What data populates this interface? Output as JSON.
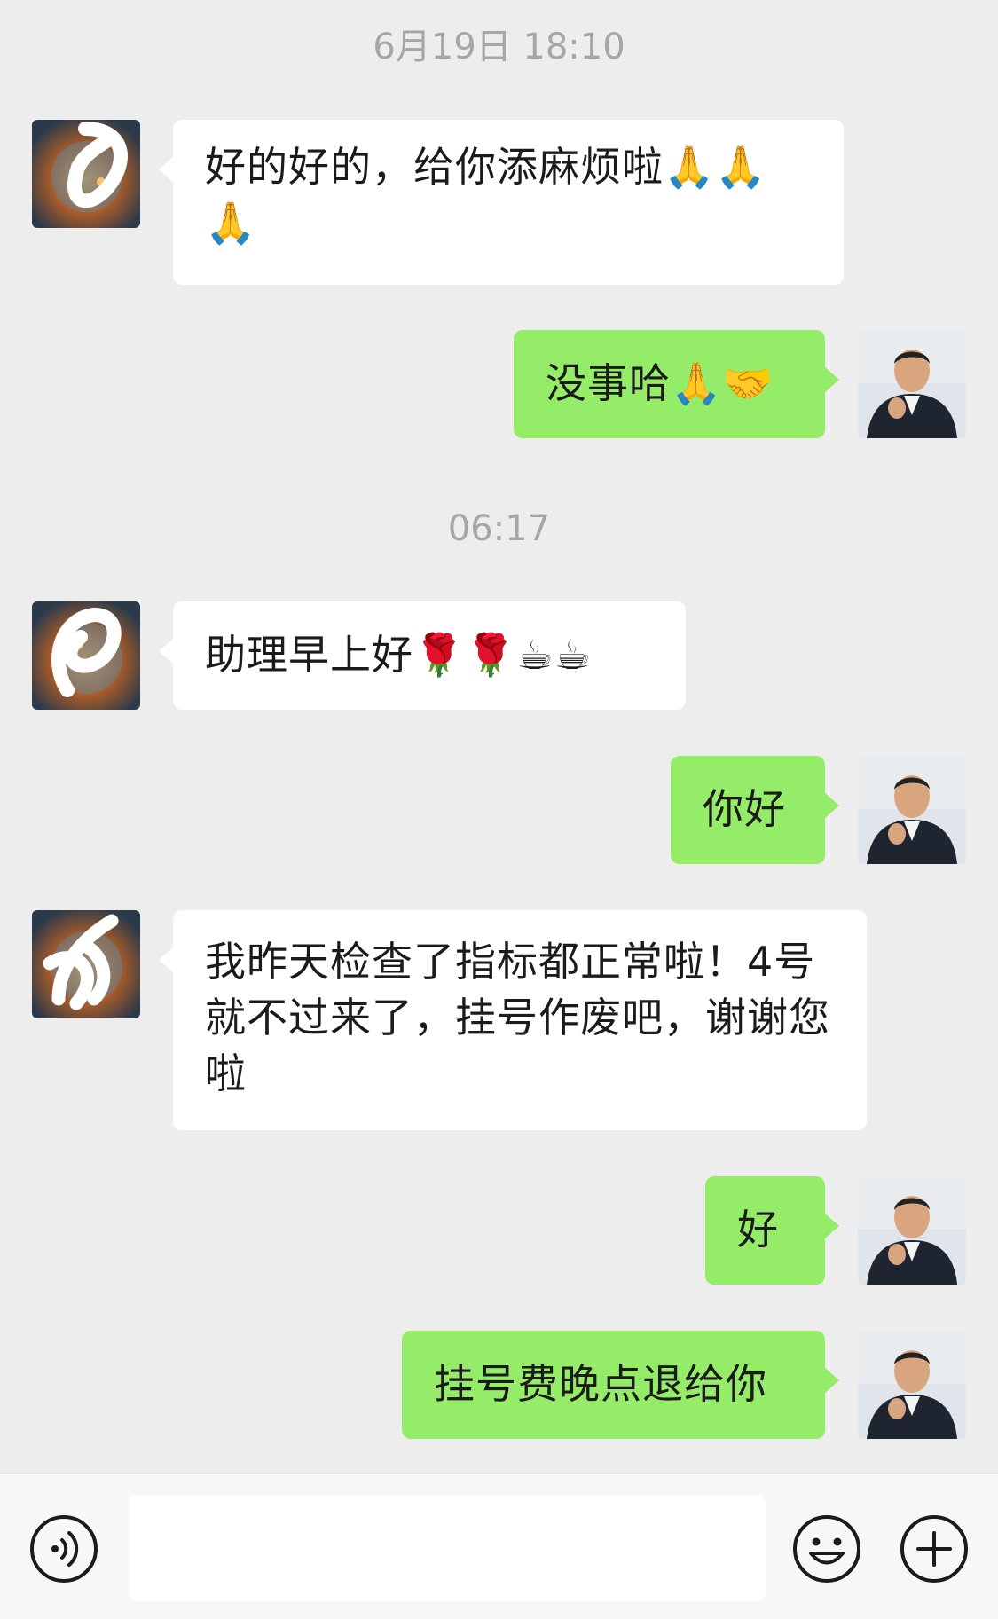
{
  "timestamps": [
    "6月19日 18:10",
    "06:17"
  ],
  "messages": [
    {
      "side": "left",
      "text": "好的好的，给你添麻烦啦🙏🙏🙏"
    },
    {
      "side": "right",
      "text": "没事哈🙏🤝"
    },
    {
      "side": "left",
      "text": "助理早上好🌹🌹☕☕"
    },
    {
      "side": "right",
      "text": "你好"
    },
    {
      "side": "left",
      "text": "我昨天检查了指标都正常啦！4号就不过来了，挂号作废吧，谢谢您啦"
    },
    {
      "side": "right",
      "text": "好"
    },
    {
      "side": "right",
      "text": "挂号费晚点退给你"
    }
  ],
  "input_bar": {
    "input_value": "",
    "icons": [
      "voice-icon",
      "emoji-icon",
      "add-icon"
    ]
  },
  "colors": {
    "background": "#ededed",
    "sent_bubble": "#95ec69",
    "received_bubble": "#ffffff",
    "timestamp_text": "#a6a6a6"
  }
}
